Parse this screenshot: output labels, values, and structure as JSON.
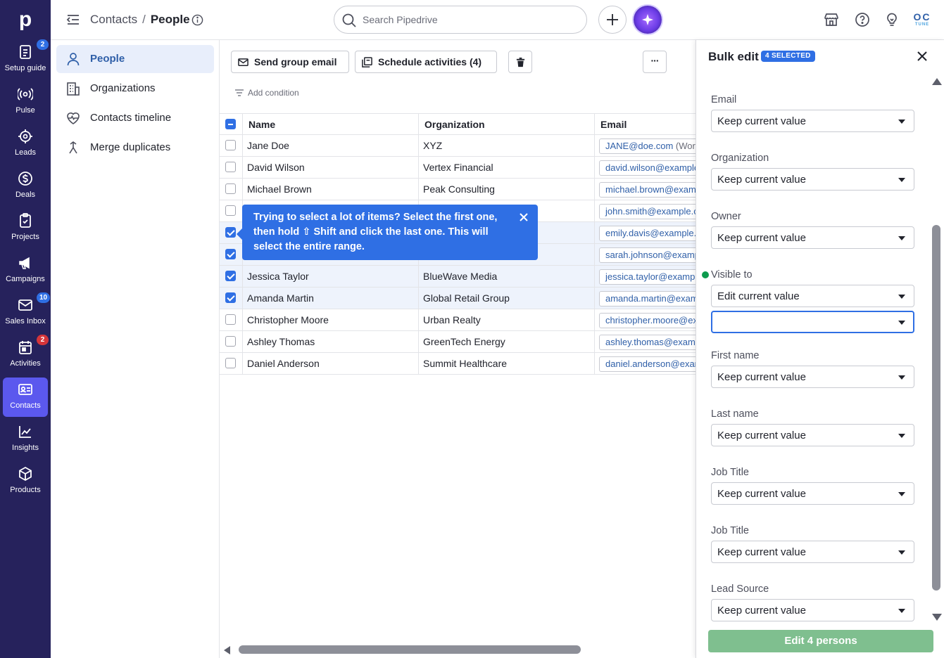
{
  "app": {
    "logo_letter": "p"
  },
  "rail": [
    {
      "label": "Setup guide",
      "icon": "setup-guide-icon",
      "badge": "2",
      "badge_color": "blue"
    },
    {
      "label": "Pulse",
      "icon": "pulse-icon"
    },
    {
      "label": "Leads",
      "icon": "leads-icon"
    },
    {
      "label": "Deals",
      "icon": "deals-icon"
    },
    {
      "label": "Projects",
      "icon": "projects-icon"
    },
    {
      "label": "Campaigns",
      "icon": "campaigns-icon"
    },
    {
      "label": "Sales Inbox",
      "icon": "sales-inbox-icon",
      "badge": "10",
      "badge_color": "blue"
    },
    {
      "label": "Activities",
      "icon": "activities-icon",
      "badge": "2",
      "badge_color": "red"
    },
    {
      "label": "Contacts",
      "icon": "contacts-icon",
      "active": true
    },
    {
      "label": "Insights",
      "icon": "insights-icon"
    },
    {
      "label": "Products",
      "icon": "products-icon"
    },
    {
      "label": "",
      "icon": "more-icon"
    }
  ],
  "header": {
    "breadcrumb_parent": "Contacts",
    "breadcrumb_sep": "/",
    "breadcrumb_current": "People",
    "search_placeholder": "Search Pipedrive",
    "company_logo": "OC",
    "company_logo_sub": "TUNE"
  },
  "subnav": [
    {
      "label": "People",
      "icon": "person-icon",
      "active": true
    },
    {
      "label": "Organizations",
      "icon": "building-icon"
    },
    {
      "label": "Contacts timeline",
      "icon": "heart-pulse-icon"
    },
    {
      "label": "Merge duplicates",
      "icon": "merge-icon"
    }
  ],
  "toolbar": {
    "send_group_email": "Send group email",
    "schedule_activities": "Schedule activities (4)",
    "more": "···",
    "add_condition": "Add condition"
  },
  "table": {
    "columns": [
      "Name",
      "Organization",
      "Email"
    ],
    "rows": [
      {
        "name": "Jane Doe",
        "org": "XYZ",
        "email": "JANE@doe.com",
        "email_suffix": " (Work",
        "selected": false
      },
      {
        "name": "David Wilson",
        "org": "Vertex Financial",
        "email": "david.wilson@example",
        "email_suffix": "",
        "selected": false
      },
      {
        "name": "Michael Brown",
        "org": "Peak Consulting",
        "email": "michael.brown@examp",
        "email_suffix": "",
        "selected": false
      },
      {
        "name": "",
        "org": "",
        "email": "john.smith@example.c",
        "email_suffix": "",
        "selected": false
      },
      {
        "name": "",
        "org": "",
        "email": "emily.davis@example.c",
        "email_suffix": "",
        "selected": true
      },
      {
        "name": "",
        "org": "",
        "email": "sarah.johnson@examp",
        "email_suffix": "",
        "selected": true
      },
      {
        "name": "Jessica Taylor",
        "org": "BlueWave Media",
        "email": "jessica.taylor@example",
        "email_suffix": "",
        "selected": true
      },
      {
        "name": "Amanda Martin",
        "org": "Global Retail Group",
        "email": "amanda.martin@examp",
        "email_suffix": "",
        "selected": true
      },
      {
        "name": "Christopher Moore",
        "org": "Urban Realty",
        "email": "christopher.moore@ex",
        "email_suffix": "",
        "selected": false
      },
      {
        "name": "Ashley Thomas",
        "org": "GreenTech Energy",
        "email": "ashley.thomas@examp",
        "email_suffix": "",
        "selected": false
      },
      {
        "name": "Daniel Anderson",
        "org": "Summit Healthcare",
        "email": "daniel.anderson@exam",
        "email_suffix": "",
        "selected": false
      }
    ]
  },
  "tooltip": {
    "text": "Trying to select a lot of items? Select the first one, then hold ⇧ Shift and click the last one. This will select the entire range."
  },
  "bulk_edit": {
    "title": "Bulk edit",
    "badge": "4 SELECTED",
    "fields": [
      {
        "label": "Email",
        "value": "Keep current value"
      },
      {
        "label": "Organization",
        "value": "Keep current value"
      },
      {
        "label": "Owner",
        "value": "Keep current value"
      },
      {
        "label": "Visible to",
        "value": "Edit current value",
        "changed": true,
        "extra_value": ""
      },
      {
        "label": "First name",
        "value": "Keep current value"
      },
      {
        "label": "Last name",
        "value": "Keep current value"
      },
      {
        "label": "Job Title",
        "value": "Keep current value"
      },
      {
        "label": "Job Title",
        "value": "Keep current value"
      },
      {
        "label": "Lead Source",
        "value": "Keep current value"
      }
    ],
    "submit": "Edit 4 persons",
    "submit_color": "#7fbf8f"
  }
}
